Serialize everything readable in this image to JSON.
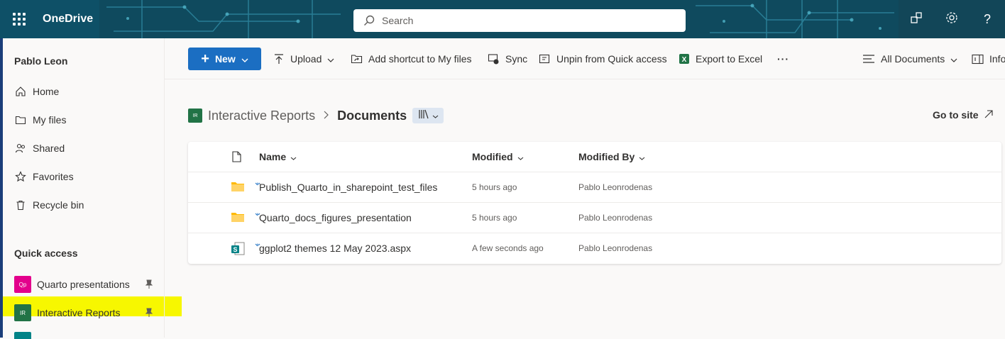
{
  "app": {
    "name": "OneDrive"
  },
  "search": {
    "placeholder": "Search"
  },
  "header_icons": [
    "feedback-icon",
    "gear-icon",
    "help-icon"
  ],
  "colors": {
    "accent": "#1b6ec2",
    "topbar": "#0f4a5e",
    "highlight": "#f7f700",
    "site_green": "#217346",
    "qp_pink": "#e3008c"
  },
  "sidebar": {
    "user": "Pablo Leon",
    "items": [
      {
        "label": "Home",
        "icon": "home-icon"
      },
      {
        "label": "My files",
        "icon": "folder-icon"
      },
      {
        "label": "Shared",
        "icon": "people-icon"
      },
      {
        "label": "Favorites",
        "icon": "star-icon"
      },
      {
        "label": "Recycle bin",
        "icon": "trash-icon"
      }
    ],
    "quick_access": {
      "title": "Quick access",
      "items": [
        {
          "label": "Quarto presentations",
          "badge": "Qp"
        },
        {
          "label": "Interactive Reports",
          "badge": "IR"
        }
      ]
    }
  },
  "command_bar": {
    "new": "New",
    "upload": "Upload",
    "add_shortcut": "Add shortcut to My files",
    "sync": "Sync",
    "unpin": "Unpin from Quick access",
    "export": "Export to Excel",
    "more": "···",
    "view": "All Documents",
    "info": "Info"
  },
  "breadcrumb": {
    "site": "Interactive Reports",
    "library": "Documents",
    "go_to_site": "Go to site"
  },
  "table": {
    "columns": {
      "name": "Name",
      "modified": "Modified",
      "modified_by": "Modified By"
    },
    "rows": [
      {
        "name": "Publish_Quarto_in_sharepoint_test_files",
        "modified": "5 hours ago",
        "modified_by": "Pablo Leonrodenas",
        "type": "folder"
      },
      {
        "name": "Quarto_docs_figures_presentation",
        "modified": "5 hours ago",
        "modified_by": "Pablo Leonrodenas",
        "type": "folder"
      },
      {
        "name": "ggplot2 themes 12 May 2023.aspx",
        "modified": "A few seconds ago",
        "modified_by": "Pablo Leonrodenas",
        "type": "page"
      }
    ]
  }
}
